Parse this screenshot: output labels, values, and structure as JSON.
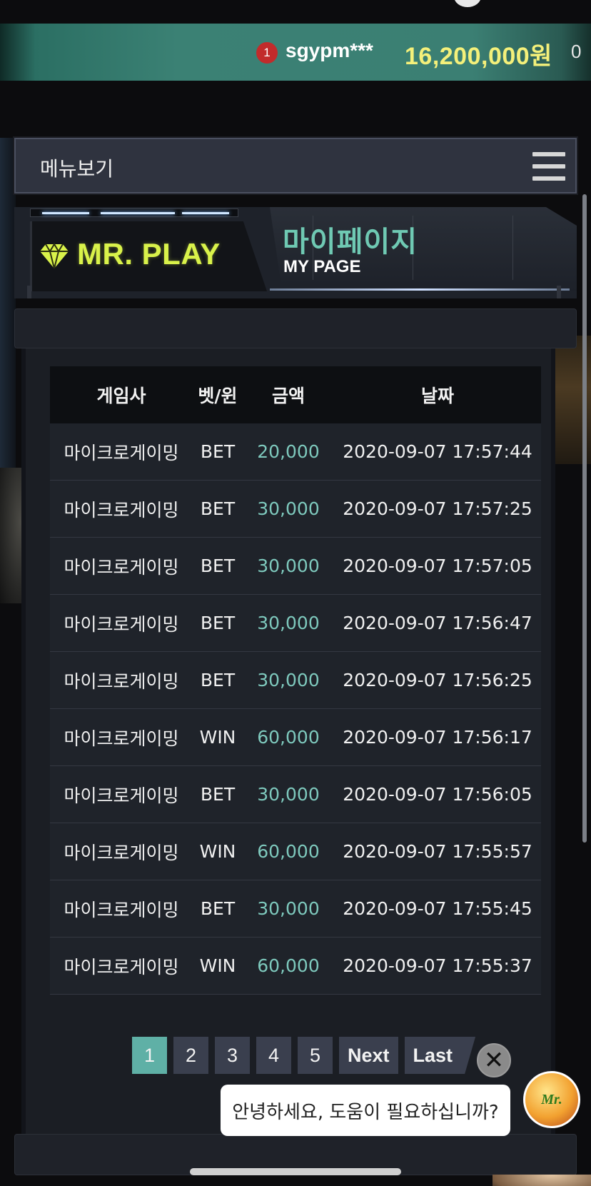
{
  "ticker": {
    "rank": "1",
    "username": "sgypm***",
    "amount": "16,200,000원",
    "overflow_text": "0"
  },
  "menu": {
    "label": "메뉴보기",
    "icon": "hamburger-icon"
  },
  "header": {
    "brand_icon": "diamond-icon",
    "brand": "MR. PLAY",
    "title_ko": "마이페이지",
    "title_en": "MY PAGE"
  },
  "colors": {
    "accent": "#5fb0a6",
    "brand": "#d9f24a",
    "amount_text": "#7ec9bd",
    "ticker_amount": "#f4f07a"
  },
  "table": {
    "columns": [
      "게임사",
      "벳/윈",
      "금액",
      "날짜"
    ],
    "rows": [
      {
        "provider": "마이크로게이밍",
        "type": "BET",
        "amount": "20,000",
        "date": "2020-09-07 17:57:44"
      },
      {
        "provider": "마이크로게이밍",
        "type": "BET",
        "amount": "30,000",
        "date": "2020-09-07 17:57:25"
      },
      {
        "provider": "마이크로게이밍",
        "type": "BET",
        "amount": "30,000",
        "date": "2020-09-07 17:57:05"
      },
      {
        "provider": "마이크로게이밍",
        "type": "BET",
        "amount": "30,000",
        "date": "2020-09-07 17:56:47"
      },
      {
        "provider": "마이크로게이밍",
        "type": "BET",
        "amount": "30,000",
        "date": "2020-09-07 17:56:25"
      },
      {
        "provider": "마이크로게이밍",
        "type": "WIN",
        "amount": "60,000",
        "date": "2020-09-07 17:56:17"
      },
      {
        "provider": "마이크로게이밍",
        "type": "BET",
        "amount": "30,000",
        "date": "2020-09-07 17:56:05"
      },
      {
        "provider": "마이크로게이밍",
        "type": "WIN",
        "amount": "60,000",
        "date": "2020-09-07 17:55:57"
      },
      {
        "provider": "마이크로게이밍",
        "type": "BET",
        "amount": "30,000",
        "date": "2020-09-07 17:55:45"
      },
      {
        "provider": "마이크로게이밍",
        "type": "WIN",
        "amount": "60,000",
        "date": "2020-09-07 17:55:37"
      }
    ]
  },
  "pagination": {
    "pages": [
      "1",
      "2",
      "3",
      "4",
      "5"
    ],
    "current": "1",
    "next_label": "Next",
    "last_label": "Last"
  },
  "chat": {
    "close_icon": "close-icon",
    "message": "안녕하세요, 도움이 필요하십니까?",
    "avatar_label": "Mr."
  }
}
